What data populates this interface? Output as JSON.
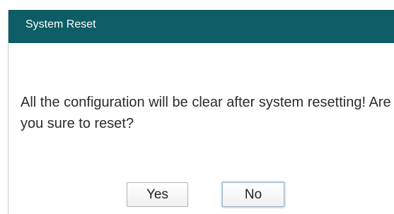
{
  "dialog": {
    "title": "System Reset",
    "message": "All the configuration will be clear after system resetting! Are you sure to reset?",
    "buttons": {
      "yes_label": "Yes",
      "no_label": "No"
    }
  },
  "colors": {
    "titlebar": "#0e5d66",
    "title_text": "#ffffff",
    "message_text": "#2c2c2c"
  }
}
